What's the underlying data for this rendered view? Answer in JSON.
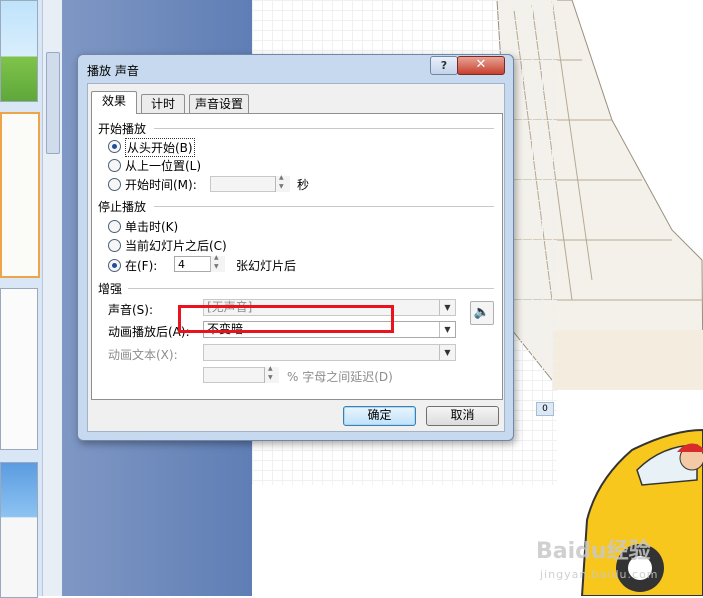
{
  "dialog": {
    "title": "播放 声音",
    "help_label": "?",
    "close_label": "✕",
    "tabs": [
      {
        "label": "效果"
      },
      {
        "label": "计时"
      },
      {
        "label": "声音设置"
      }
    ],
    "start": {
      "heading": "开始播放",
      "from_start": "从头开始(B)",
      "from_last": "从上一位置(L)",
      "start_time": "开始时间(M):",
      "seconds_unit": "秒"
    },
    "stop": {
      "heading": "停止播放",
      "on_click": "单击时(K)",
      "after_current": "当前幻灯片之后(C)",
      "after_label": "在(F):",
      "after_value": "4",
      "after_unit": "张幻灯片后"
    },
    "enhance": {
      "heading": "增强",
      "sound_label": "声音(S):",
      "sound_value": "[无声音]",
      "after_anim_label": "动画播放后(A):",
      "after_anim_value": "不变暗",
      "anim_text_label": "动画文本(X):",
      "anim_text_value": "",
      "delay_label": "% 字母之间延迟(D)"
    },
    "ok_label": "确定",
    "cancel_label": "取消"
  },
  "background": {
    "badge": "0",
    "watermark": "Baidu经验",
    "watermark_sub": "jingyan.baidu.com"
  }
}
